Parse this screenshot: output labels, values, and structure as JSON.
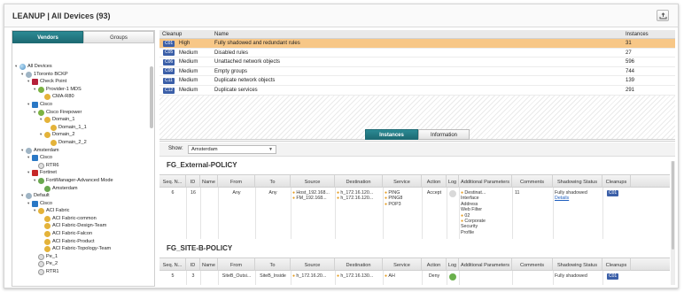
{
  "title": "LEANUP | All Devices (93)",
  "left_tabs": [
    "Vendors",
    "Groups"
  ],
  "tree": [
    {
      "label": "All Devices",
      "depth": 0,
      "icon": "globe-icon",
      "toggle": "expanded"
    },
    {
      "label": "1Toronto BCKP",
      "depth": 1,
      "icon": "cluster-icon",
      "toggle": "expanded"
    },
    {
      "label": "Check Point",
      "depth": 2,
      "icon": "checkpoint-icon",
      "toggle": "expanded"
    },
    {
      "label": "Provider-1 MDS",
      "depth": 3,
      "icon": "provider-icon",
      "toggle": "expanded"
    },
    {
      "label": "CMA-R80",
      "depth": 4,
      "icon": "domain-icon",
      "toggle": ""
    },
    {
      "label": "Cisco",
      "depth": 2,
      "icon": "cisco-icon",
      "toggle": "expanded"
    },
    {
      "label": "Cisco Firepower",
      "depth": 3,
      "icon": "provider-icon",
      "toggle": "expanded"
    },
    {
      "label": "Domain_1",
      "depth": 4,
      "icon": "domain-icon",
      "toggle": "expanded"
    },
    {
      "label": "Domain_1_1",
      "depth": 5,
      "icon": "domain-icon",
      "toggle": ""
    },
    {
      "label": "Domain_2",
      "depth": 4,
      "icon": "domain-icon",
      "toggle": "expanded"
    },
    {
      "label": "Domain_2_2",
      "depth": 5,
      "icon": "domain-icon",
      "toggle": ""
    },
    {
      "label": "Amsterdam",
      "depth": 1,
      "icon": "cluster-icon",
      "toggle": "expanded"
    },
    {
      "label": "Cisco",
      "depth": 2,
      "icon": "cisco-icon",
      "toggle": "expanded"
    },
    {
      "label": "RTR6",
      "depth": 3,
      "icon": "router-icon",
      "toggle": ""
    },
    {
      "label": "Fortinet",
      "depth": 2,
      "icon": "fortinet-icon",
      "toggle": "expanded"
    },
    {
      "label": "FortiManager-Advanced Mode",
      "depth": 3,
      "icon": "fortimanager-icon",
      "toggle": "expanded"
    },
    {
      "label": "Amsterdam",
      "depth": 4,
      "icon": "fortimanager-icon",
      "toggle": ""
    },
    {
      "label": "Default",
      "depth": 1,
      "icon": "cluster-icon",
      "toggle": "expanded"
    },
    {
      "label": "Cisco",
      "depth": 2,
      "icon": "cisco-icon",
      "toggle": "expanded"
    },
    {
      "label": "ACI Fabric",
      "depth": 3,
      "icon": "domain-icon",
      "toggle": "expanded"
    },
    {
      "label": "ACI Fabric-common",
      "depth": 4,
      "icon": "domain-icon",
      "toggle": ""
    },
    {
      "label": "ACI Fabric-Design-Team",
      "depth": 4,
      "icon": "domain-icon",
      "toggle": ""
    },
    {
      "label": "ACI Fabric-Falcon",
      "depth": 4,
      "icon": "domain-icon",
      "toggle": ""
    },
    {
      "label": "ACI Fabric-Product",
      "depth": 4,
      "icon": "domain-icon",
      "toggle": ""
    },
    {
      "label": "ACI Fabric-Topology-Team",
      "depth": 4,
      "icon": "domain-icon",
      "toggle": ""
    },
    {
      "label": "Pe_1",
      "depth": 3,
      "icon": "router-icon",
      "toggle": ""
    },
    {
      "label": "Pe_2",
      "depth": 3,
      "icon": "router-icon",
      "toggle": ""
    },
    {
      "label": "RTR1",
      "depth": 3,
      "icon": "router-icon",
      "toggle": ""
    }
  ],
  "cleanup": {
    "headers": {
      "cleanup": "Cleanup",
      "name": "Name",
      "instances": "Instances"
    },
    "rows": [
      {
        "code": "C01",
        "severity": "High",
        "name": "Fully shadowed and redundant rules",
        "instances": "31",
        "selected": true
      },
      {
        "code": "C05",
        "severity": "Medium",
        "name": "Disabled rules",
        "instances": "27",
        "selected": false
      },
      {
        "code": "C06",
        "severity": "Medium",
        "name": "Unattached network objects",
        "instances": "596",
        "selected": false
      },
      {
        "code": "C08",
        "severity": "Medium",
        "name": "Empty groups",
        "instances": "744",
        "selected": false
      },
      {
        "code": "C11",
        "severity": "Medium",
        "name": "Duplicate network objects",
        "instances": "139",
        "selected": false
      },
      {
        "code": "C12",
        "severity": "Medium",
        "name": "Duplicate services",
        "instances": "291",
        "selected": false
      }
    ]
  },
  "inner_tabs": [
    "Instances",
    "Information"
  ],
  "show": {
    "label": "Show:",
    "value": "Amsterdam"
  },
  "policy_headers": [
    "Seq. N...",
    "ID",
    "Name",
    "From",
    "To",
    "Source",
    "Destination",
    "Service",
    "Action",
    "Log",
    "Additional Parameters",
    "Comments",
    "Shadowing Status",
    "Cleanups"
  ],
  "policies": [
    {
      "title": "FG_External-POLICY",
      "row": {
        "seq": "6",
        "id": "16",
        "name": "",
        "from": "Any",
        "to": "Any",
        "source": [
          "Host_192.168...",
          "FM_192.168..."
        ],
        "destination": [
          "h_172.16.120...",
          "h_172.16.120..."
        ],
        "service": [
          "PING",
          "PING8",
          "POP3"
        ],
        "action": "Accept",
        "additional": [
          "Destinat...",
          "Interface",
          "Address",
          "Web Filter",
          "02",
          "Corporate",
          "Security",
          "Profile"
        ],
        "comments": "11",
        "shadowing": "Fully shadowed",
        "shadowing_link": "Details",
        "cleanup": "C01"
      }
    },
    {
      "title": "FG_SITE-B-POLICY",
      "row": {
        "seq": "5",
        "id": "3",
        "name": "",
        "from": "SiteB_Outsi...",
        "to": "SiteB_Inside",
        "source": [
          "h_172.16.20..."
        ],
        "destination": [
          "h_172.16.130..."
        ],
        "service": [
          "AH"
        ],
        "action": "Deny",
        "additional": [],
        "comments": "",
        "shadowing": "Fully shadowed",
        "shadowing_link": "",
        "cleanup": "C01"
      }
    }
  ],
  "colors": {
    "accent": "#1d6a73",
    "selected_row": "#f7c787",
    "badge": "#3b5fa8"
  }
}
